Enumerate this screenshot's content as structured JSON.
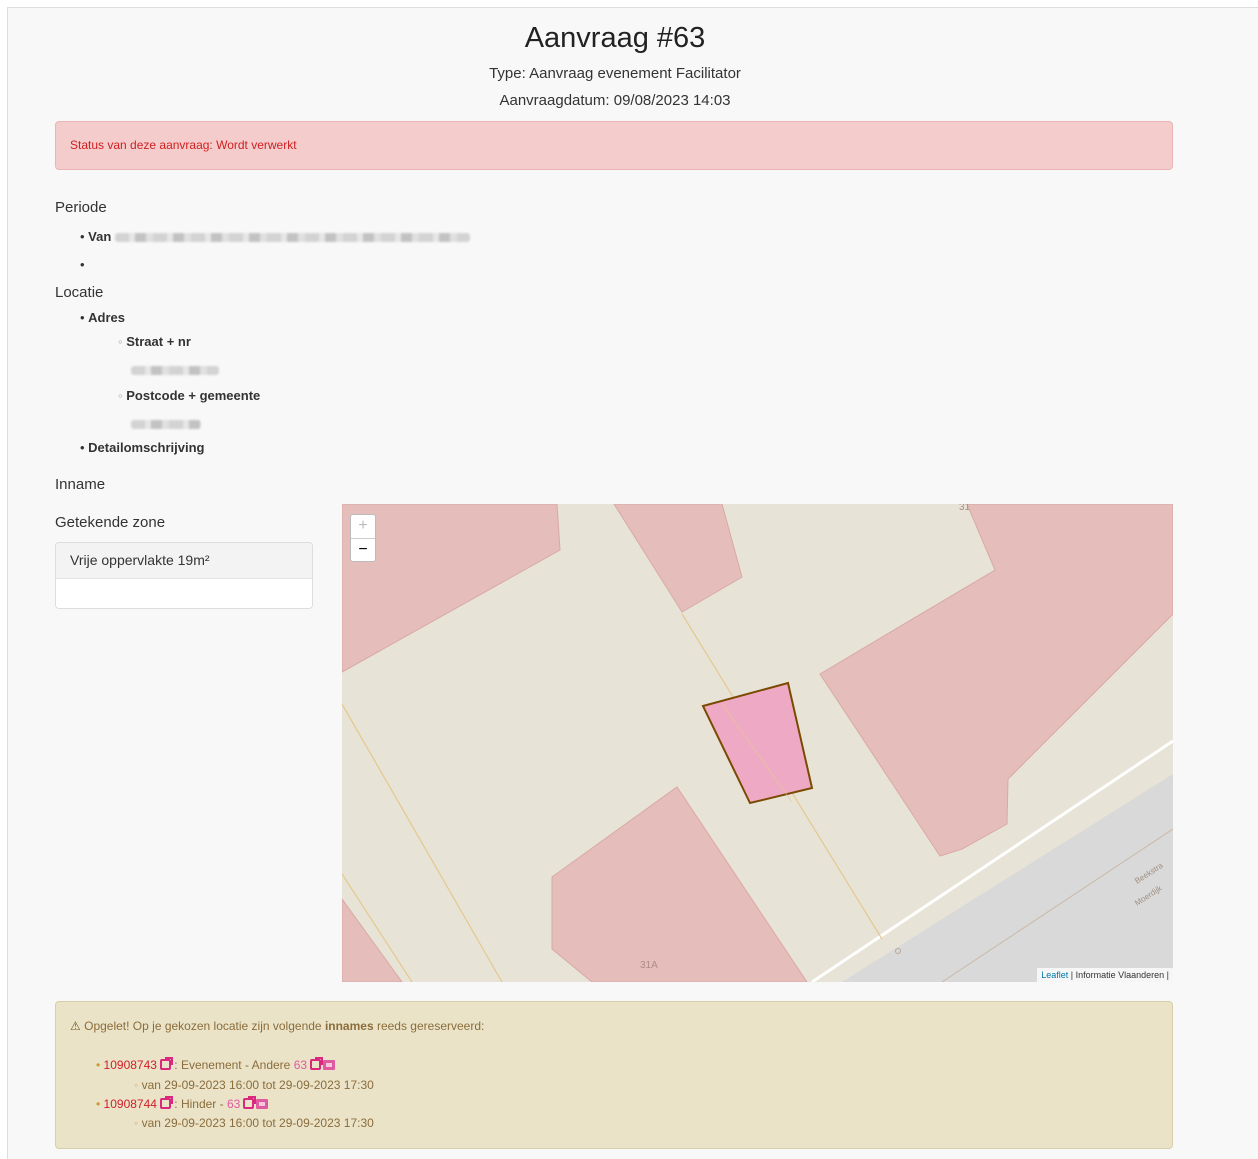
{
  "header": {
    "title": "Aanvraag #63",
    "type": "Type: Aanvraag evenement Facilitator",
    "date": "Aanvraagdatum: 09/08/2023 14:03"
  },
  "status": "Status van deze aanvraag: Wordt verwerkt",
  "periode": {
    "heading": "Periode",
    "van_label": "Van"
  },
  "locatie": {
    "heading": "Locatie",
    "adres_label": "Adres",
    "straat_label": "Straat + nr",
    "postcode_label": "Postcode + gemeente",
    "detail_label": "Detailomschrijving"
  },
  "inname": {
    "heading": "Inname"
  },
  "zone": {
    "heading": "Getekende zone",
    "card_title": "Vrije oppervlakte 19m²"
  },
  "map": {
    "zoom_in": "+",
    "zoom_out": "−",
    "label_top": "31",
    "label_bottom": "31A",
    "street1": "Beekstra",
    "street2": "Moerdijk",
    "attribution_link": "Leaflet",
    "attribution_text": " | Informatie Vlaanderen |",
    "colors": {
      "background": "#e8e3d7",
      "building": "#e5bebb",
      "zone": "#eeaac4",
      "road": "#d9d9d9"
    }
  },
  "warning": {
    "prefix": "Opgelet! Op je gekozen locatie zijn volgende ",
    "bold": "innames",
    "suffix": " reeds gereserveerd:",
    "items": [
      {
        "id": "10908743",
        "desc": " : Evenement - Andere ",
        "ref": "63",
        "period": "van 29-09-2023 16:00 tot 29-09-2023 17:30"
      },
      {
        "id": "10908744",
        "desc": " : Hinder - ",
        "ref": "63",
        "period": "van 29-09-2023 16:00 tot 29-09-2023 17:30"
      }
    ]
  }
}
